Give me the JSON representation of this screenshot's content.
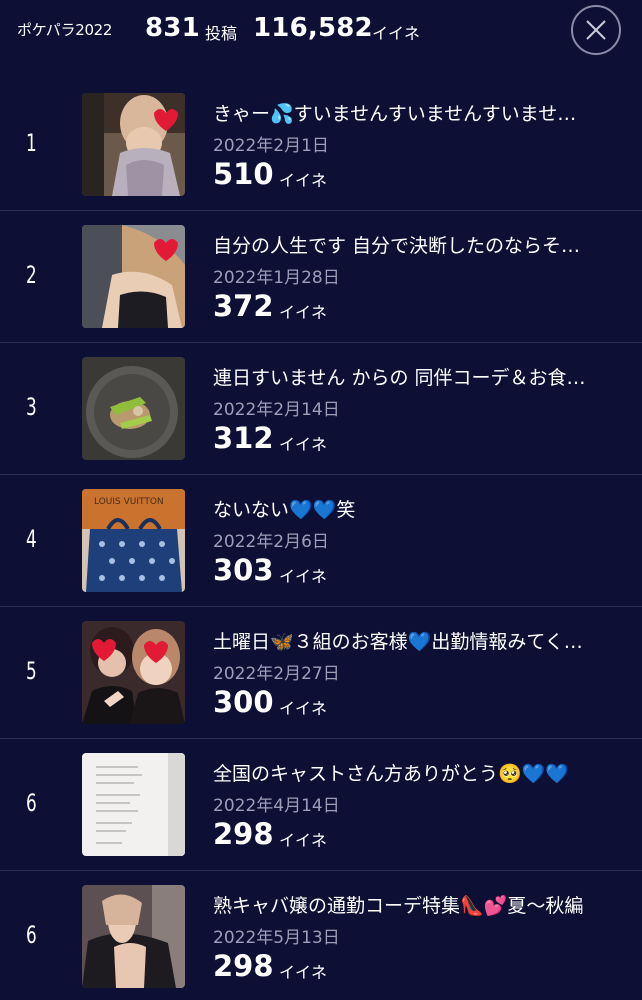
{
  "header": {
    "title": "ポケパラ2022",
    "post_count": "831",
    "post_unit": "投稿",
    "likes_total": "116,582",
    "likes_unit": "イイネ"
  },
  "colors": {
    "background": "#0e0f35",
    "divider": "#2a2c55",
    "date_text": "#9d9fb8",
    "close_ring": "#8a8ba6"
  },
  "icons": {
    "close": "close-icon"
  },
  "posts": [
    {
      "rank": "1",
      "title": "きゃー💦すいませんすいませんすいませ…",
      "date": "2022年2月1日",
      "likes": "510",
      "likes_unit": "イイネ"
    },
    {
      "rank": "2",
      "title": "自分の人生です 自分で決断したのならそ…",
      "date": "2022年1月28日",
      "likes": "372",
      "likes_unit": "イイネ"
    },
    {
      "rank": "3",
      "title": "連日すいません からの 同伴コーデ＆お食…",
      "date": "2022年2月14日",
      "likes": "312",
      "likes_unit": "イイネ"
    },
    {
      "rank": "4",
      "title": "ないない💙💙笑",
      "date": "2022年2月6日",
      "likes": "303",
      "likes_unit": "イイネ"
    },
    {
      "rank": "5",
      "title": "土曜日🦋３組のお客様💙出勤情報みてく…",
      "date": "2022年2月27日",
      "likes": "300",
      "likes_unit": "イイネ"
    },
    {
      "rank": "6",
      "title": "全国のキャストさん方ありがとう🥺💙💙",
      "date": "2022年4月14日",
      "likes": "298",
      "likes_unit": "イイネ"
    },
    {
      "rank": "6",
      "title": "熟キャバ嬢の通勤コーデ特集👠💕夏〜秋編",
      "date": "2022年5月13日",
      "likes": "298",
      "likes_unit": "イイネ"
    }
  ]
}
